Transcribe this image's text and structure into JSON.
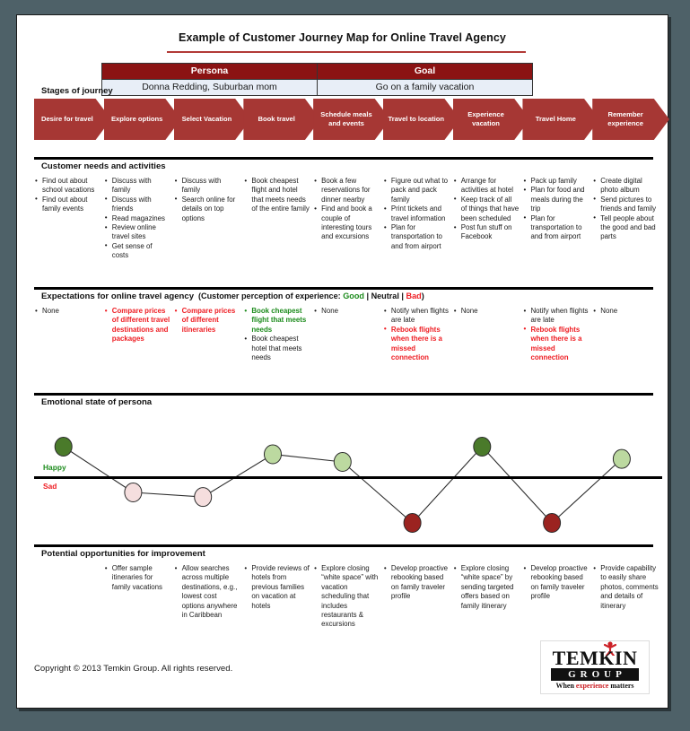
{
  "title": "Example of Customer Journey Map for Online Travel Agency",
  "persona_table": {
    "headers": [
      "Persona",
      "Goal"
    ],
    "values": [
      "Donna Redding, Suburban mom",
      "Go on a family vacation"
    ]
  },
  "stages": {
    "label": "Stages of journey",
    "items": [
      "Desire for travel",
      "Explore options",
      "Select Vacation",
      "Book travel",
      "Schedule meals and events",
      "Travel to location",
      "Experience vacation",
      "Travel Home",
      "Remember experience"
    ]
  },
  "needs": {
    "title": "Customer needs and activities",
    "columns": [
      {
        "items": [
          {
            "text": "Find out about school vacations",
            "tone": "neutral"
          },
          {
            "text": "Find out about family events",
            "tone": "neutral"
          }
        ]
      },
      {
        "items": [
          {
            "text": "Discuss with family",
            "tone": "neutral"
          },
          {
            "text": "Discuss with friends",
            "tone": "neutral"
          },
          {
            "text": "Read magazines",
            "tone": "neutral"
          },
          {
            "text": "Review online travel sites",
            "tone": "neutral"
          },
          {
            "text": "Get sense of costs",
            "tone": "neutral"
          }
        ]
      },
      {
        "items": [
          {
            "text": "Discuss with family",
            "tone": "neutral"
          },
          {
            "text": "Search online for details on top options",
            "tone": "neutral"
          }
        ]
      },
      {
        "items": [
          {
            "text": "Book cheapest flight and hotel that meets needs of the entire family",
            "tone": "neutral"
          }
        ]
      },
      {
        "items": [
          {
            "text": "Book a few reservations for dinner nearby",
            "tone": "neutral"
          },
          {
            "text": "Find and book a couple of interesting tours and excursions",
            "tone": "neutral"
          }
        ]
      },
      {
        "items": [
          {
            "text": "Figure out what to pack and pack family",
            "tone": "neutral"
          },
          {
            "text": "Print tickets and travel information",
            "tone": "neutral"
          },
          {
            "text": "Plan for transportation to and from airport",
            "tone": "neutral"
          }
        ]
      },
      {
        "items": [
          {
            "text": "Arrange for activities at hotel",
            "tone": "neutral"
          },
          {
            "text": "Keep track of all of things that have been scheduled",
            "tone": "neutral"
          },
          {
            "text": "Post fun stuff on Facebook",
            "tone": "neutral"
          }
        ]
      },
      {
        "items": [
          {
            "text": "Pack up family",
            "tone": "neutral"
          },
          {
            "text": "Plan for food and meals during the trip",
            "tone": "neutral"
          },
          {
            "text": "Plan for transportation to and from airport",
            "tone": "neutral"
          }
        ]
      },
      {
        "items": [
          {
            "text": "Create digital photo album",
            "tone": "neutral"
          },
          {
            "text": "Send pictures to friends and family",
            "tone": "neutral"
          },
          {
            "text": "Tell people about the good and bad parts",
            "tone": "neutral"
          }
        ]
      }
    ]
  },
  "expectations": {
    "title": "Expectations for online travel agency",
    "legend_prefix": "(Customer perception of experience: ",
    "legend_good": "Good",
    "legend_sep1": " | ",
    "legend_neutral": "Neutral",
    "legend_sep2": " | ",
    "legend_bad": "Bad",
    "legend_suffix": ")",
    "columns": [
      {
        "items": [
          {
            "text": "None",
            "tone": "neutral"
          }
        ]
      },
      {
        "items": [
          {
            "text": "Compare prices of different travel destinations and packages",
            "tone": "bad"
          }
        ]
      },
      {
        "items": [
          {
            "text": "Compare prices of different itineraries",
            "tone": "bad"
          }
        ]
      },
      {
        "items": [
          {
            "text": "Book cheapest flight that meets needs",
            "tone": "good"
          },
          {
            "text": "Book cheapest hotel that meets needs",
            "tone": "neutral"
          }
        ]
      },
      {
        "items": [
          {
            "text": "None",
            "tone": "neutral"
          }
        ]
      },
      {
        "items": [
          {
            "text": "Notify when flights are late",
            "tone": "neutral"
          },
          {
            "text": "Rebook flights when there is a missed connection",
            "tone": "bad"
          }
        ]
      },
      {
        "items": [
          {
            "text": "None",
            "tone": "neutral"
          }
        ]
      },
      {
        "items": [
          {
            "text": "Notify when flights are late",
            "tone": "neutral"
          },
          {
            "text": "Rebook flights when there is a missed connection",
            "tone": "bad"
          }
        ]
      },
      {
        "items": [
          {
            "text": "None",
            "tone": "neutral"
          }
        ]
      }
    ]
  },
  "emotions": {
    "title": "Emotional state of persona",
    "happy_label": "Happy",
    "sad_label": "Sad"
  },
  "opportunities": {
    "title": "Potential opportunities for improvement",
    "columns": [
      {
        "items": []
      },
      {
        "items": [
          {
            "text": "Offer sample itineraries for family vacations",
            "tone": "neutral"
          }
        ]
      },
      {
        "items": [
          {
            "text": "Allow searches across multiple destinations, e.g., lowest cost options anywhere in Caribbean",
            "tone": "neutral"
          }
        ]
      },
      {
        "items": [
          {
            "text": "Provide reviews of hotels from previous families on vacation at hotels",
            "tone": "neutral"
          }
        ]
      },
      {
        "items": [
          {
            "text": "Explore closing “white space” with vacation scheduling that includes restaurants & excursions",
            "tone": "neutral"
          }
        ]
      },
      {
        "items": [
          {
            "text": "Develop proactive rebooking based on family traveler profile",
            "tone": "neutral"
          }
        ]
      },
      {
        "items": [
          {
            "text": "Explore closing “white space” by sending targeted offers based on family itinerary",
            "tone": "neutral"
          }
        ]
      },
      {
        "items": [
          {
            "text": "Develop proactive rebooking based on family traveler profile",
            "tone": "neutral"
          }
        ]
      },
      {
        "items": [
          {
            "text": "Provide capability to easily share photos, comments and details of itinerary",
            "tone": "neutral"
          }
        ]
      }
    ]
  },
  "footer": {
    "copyright": "Copyright © 2013 Temkin Group. All rights reserved.",
    "logo_name": "TEMKIN",
    "logo_sub": "GROUP",
    "logo_tag_a": "When ",
    "logo_tag_b": "experience",
    "logo_tag_c": " matters"
  },
  "colors": {
    "chevron": "#a63734",
    "header_red": "#8b1313",
    "good": "#1c8b1c",
    "bad": "#ee1c22",
    "dot_dark_green": "#4a7a2a",
    "dot_light_green": "#bcd9a0",
    "dot_pink": "#f5dede",
    "dot_dark_red": "#9b2320",
    "page_bg": "#ffffff",
    "canvas_bg": "#4e6168"
  },
  "chart_data": {
    "type": "line",
    "title": "Emotional state of persona",
    "xlabel": "",
    "ylabel": "",
    "grid": false,
    "legend": [
      "Happy",
      "Sad"
    ],
    "axis_labels": {
      "above": "Happy",
      "below": "Sad"
    },
    "categories": [
      "Desire for travel",
      "Explore options",
      "Select Vacation",
      "Book travel",
      "Schedule meals and events",
      "Travel to location",
      "Experience vacation",
      "Travel Home",
      "Remember experience"
    ],
    "values": [
      2,
      -1,
      -1.3,
      1.5,
      1,
      -3,
      2,
      -3,
      1.2
    ],
    "ylim": [
      -3.5,
      2.5
    ],
    "point_colors": [
      "#4a7a2a",
      "#f5dede",
      "#f5dede",
      "#bcd9a0",
      "#bcd9a0",
      "#9b2320",
      "#4a7a2a",
      "#9b2320",
      "#bcd9a0"
    ],
    "point_states": [
      "very happy",
      "slightly sad",
      "slightly sad",
      "happy",
      "happy",
      "very sad",
      "very happy",
      "very sad",
      "happy"
    ]
  }
}
